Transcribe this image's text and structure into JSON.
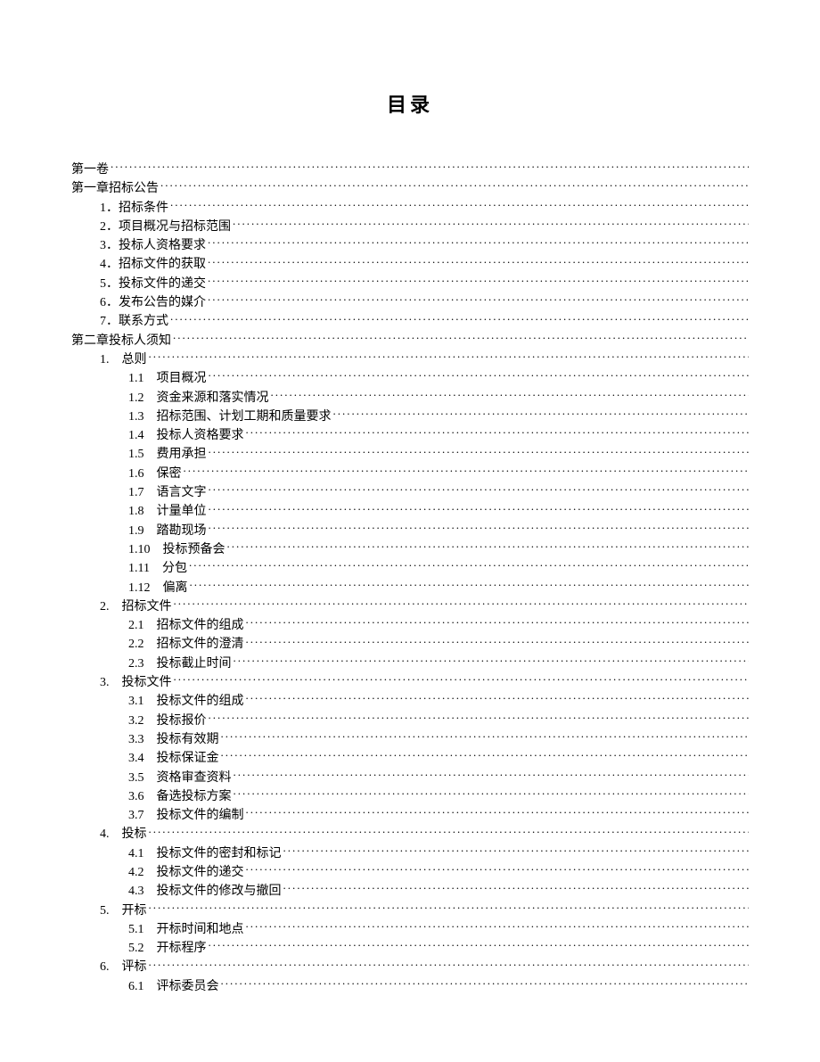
{
  "title": "目录",
  "entries": [
    {
      "level": 0,
      "text": "第一卷"
    },
    {
      "level": 0,
      "text": "第一章招标公告"
    },
    {
      "level": 1,
      "text": "1．招标条件"
    },
    {
      "level": 1,
      "text": "2．项目概况与招标范围"
    },
    {
      "level": 1,
      "text": "3．投标人资格要求"
    },
    {
      "level": 1,
      "text": "4．招标文件的获取"
    },
    {
      "level": 1,
      "text": "5．投标文件的递交"
    },
    {
      "level": 1,
      "text": "6．发布公告的媒介"
    },
    {
      "level": 1,
      "text": "7．联系方式"
    },
    {
      "level": 0,
      "text": "第二章投标人须知"
    },
    {
      "level": 1,
      "text": "1.　总则"
    },
    {
      "level": 2,
      "text": "1.1　项目概况"
    },
    {
      "level": 2,
      "text": "1.2　资金来源和落实情况"
    },
    {
      "level": 2,
      "text": "1.3　招标范围、计划工期和质量要求"
    },
    {
      "level": 2,
      "text": "1.4　投标人资格要求"
    },
    {
      "level": 2,
      "text": "1.5　费用承担"
    },
    {
      "level": 2,
      "text": "1.6　保密"
    },
    {
      "level": 2,
      "text": "1.7　语言文字"
    },
    {
      "level": 2,
      "text": "1.8　计量单位"
    },
    {
      "level": 2,
      "text": "1.9　踏勘现场"
    },
    {
      "level": 2,
      "text": "1.10　投标预备会"
    },
    {
      "level": 2,
      "text": "1.11　分包"
    },
    {
      "level": 2,
      "text": "1.12　偏离"
    },
    {
      "level": 1,
      "text": "2.　招标文件"
    },
    {
      "level": 2,
      "text": "2.1　招标文件的组成"
    },
    {
      "level": 2,
      "text": "2.2　招标文件的澄清"
    },
    {
      "level": 2,
      "text": "2.3　投标截止时间"
    },
    {
      "level": 1,
      "text": "3.　投标文件"
    },
    {
      "level": 2,
      "text": "3.1　投标文件的组成"
    },
    {
      "level": 2,
      "text": "3.2　投标报价"
    },
    {
      "level": 2,
      "text": "3.3　投标有效期"
    },
    {
      "level": 2,
      "text": "3.4　投标保证金"
    },
    {
      "level": 2,
      "text": "3.5　资格审查资料"
    },
    {
      "level": 2,
      "text": "3.6　备选投标方案"
    },
    {
      "level": 2,
      "text": "3.7　投标文件的编制"
    },
    {
      "level": 1,
      "text": "4.　投标"
    },
    {
      "level": 2,
      "text": "4.1　投标文件的密封和标记"
    },
    {
      "level": 2,
      "text": "4.2　投标文件的递交"
    },
    {
      "level": 2,
      "text": "4.3　投标文件的修改与撤回"
    },
    {
      "level": 1,
      "text": "5.　开标"
    },
    {
      "level": 2,
      "text": "5.1　开标时间和地点"
    },
    {
      "level": 2,
      "text": "5.2　开标程序"
    },
    {
      "level": 1,
      "text": "6.　评标"
    },
    {
      "level": 2,
      "text": "6.1　评标委员会"
    }
  ]
}
